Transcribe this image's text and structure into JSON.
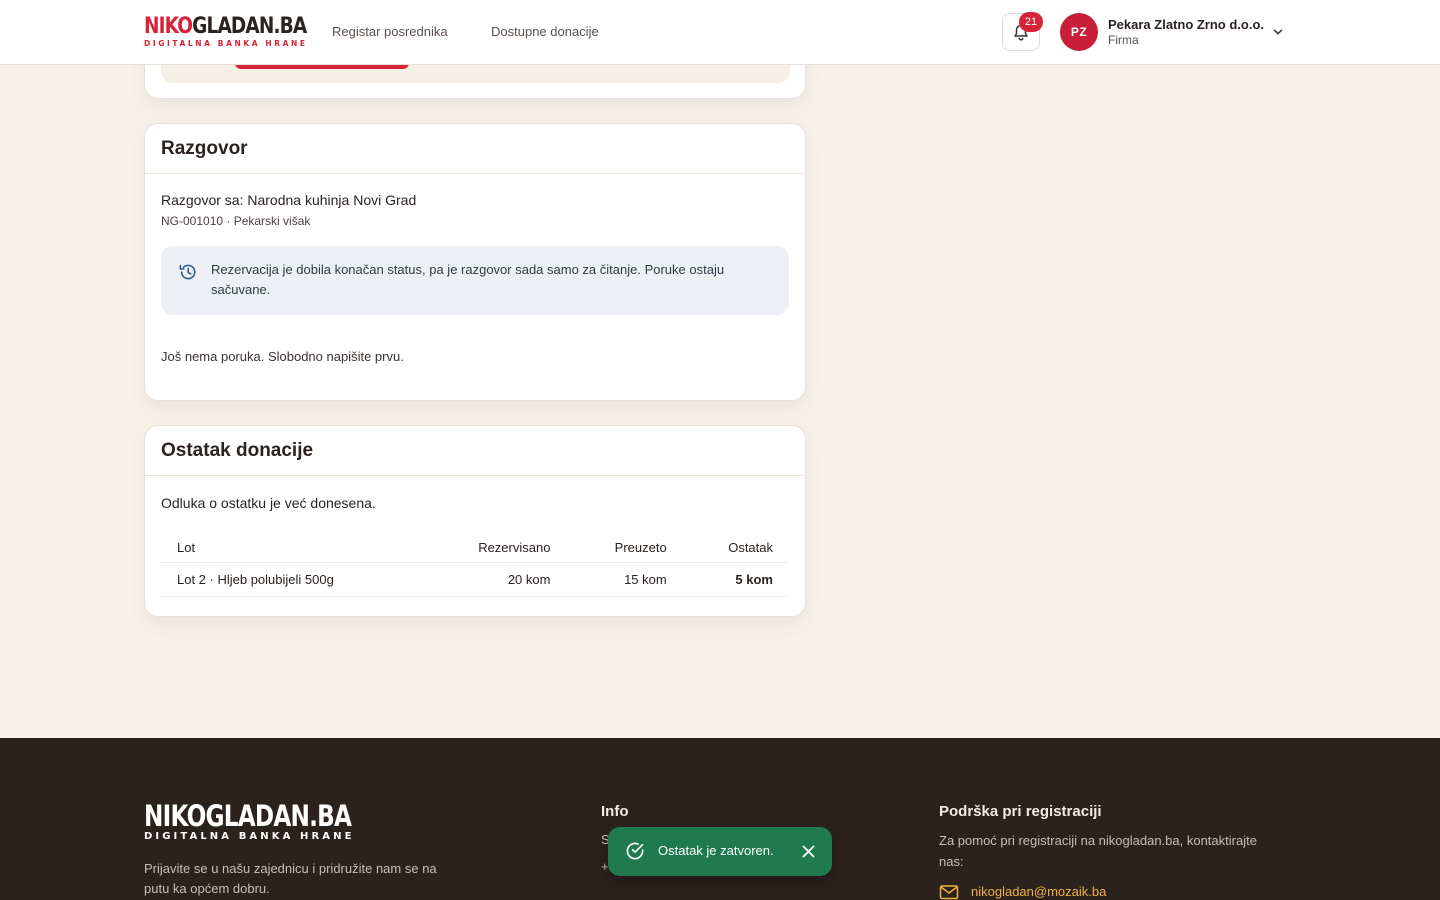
{
  "header": {
    "logo_main_red": "NIKO",
    "logo_main_dark": "GLADAN.BA",
    "logo_tagline": "DIGITALNA BANKA HRANE",
    "nav": [
      "Registar posrednika",
      "Dostupne donacije"
    ],
    "notification_count": "21",
    "user": {
      "initials": "PZ",
      "name": "Pekara Zlatno Zrno d.o.o.",
      "role": "Firma"
    }
  },
  "chat": {
    "title": "Razgovor",
    "with": "Razgovor sa: Narodna kuhinja Novi Grad",
    "meta": "NG-001010 · Pekarski višak",
    "info": "Rezervacija je dobila konačan status, pa je razgovor sada samo za čitanje. Poruke ostaju sačuvane.",
    "empty": "Još nema poruka. Slobodno napišite prvu."
  },
  "remainder": {
    "title": "Ostatak donacije",
    "decision": "Odluka o ostatku je već donesena.",
    "columns": [
      "Lot",
      "Rezervisano",
      "Preuzeto",
      "Ostatak"
    ],
    "rows": [
      [
        "Lot 2 · Hljeb polubijeli 500g",
        "20 kom",
        "15 kom",
        "5 kom"
      ]
    ]
  },
  "footer": {
    "logo_main": "NIKOGLADAN.BA",
    "logo_tagline": "DIGITALNA BANKA HRANE",
    "description": "Prijavite se u našu zajednicu i pridružite nam se na putu ka općem dobru.",
    "info_title": "Info",
    "info_line1": "S",
    "info_line2": "+3",
    "support_title": "Podrška pri registraciji",
    "support_text": "Za pomoć pri registraciji na nikogladan.ba, kontaktirajte nas:",
    "support_email": "nikogladan@mozaik.ba"
  },
  "toast": {
    "message": "Ostatak je zatvoren."
  },
  "colors": {
    "brand_red": "#d6233a",
    "toast_green": "#1f7a4d",
    "footer_bg": "#2b211d",
    "email_accent": "#f0b23f"
  }
}
